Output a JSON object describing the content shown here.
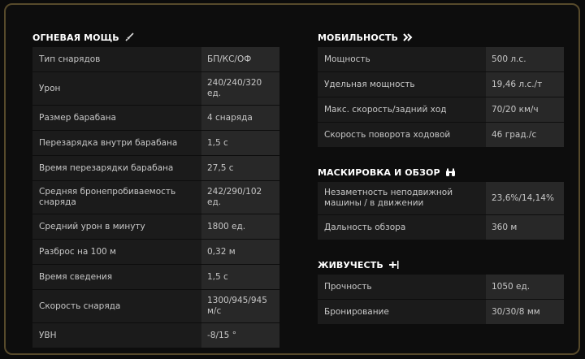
{
  "firepower": {
    "title": "ОГНЕВАЯ МОЩЬ",
    "icon": "sword-icon",
    "rows": [
      {
        "label": "Тип снарядов",
        "value": "БП/КС/ОФ"
      },
      {
        "label": "Урон",
        "value": "240/240/320 ед."
      },
      {
        "label": "Размер барабана",
        "value": "4 снаряда"
      },
      {
        "label": "Перезарядка внутри барабана",
        "value": "1,5 с"
      },
      {
        "label": "Время перезарядки барабана",
        "value": "27,5 с"
      },
      {
        "label": "Средняя бронепробиваемость снаряда",
        "value": "242/290/102 ед."
      },
      {
        "label": "Средний урон в минуту",
        "value": "1800 ед."
      },
      {
        "label": "Разброс на 100 м",
        "value": "0,32 м"
      },
      {
        "label": "Время сведения",
        "value": "1,5 с"
      },
      {
        "label": "Скорость снаряда",
        "value": "1300/945/945 м/с"
      },
      {
        "label": "УВН",
        "value": "-8/15 °"
      }
    ]
  },
  "mobility": {
    "title": "МОБИЛЬНОСТЬ",
    "icon": "double-chevron-right-icon",
    "rows": [
      {
        "label": "Мощность",
        "value": "500 л.с."
      },
      {
        "label": "Удельная мощность",
        "value": "19,46 л.с./т"
      },
      {
        "label": "Макс. скорость/задний ход",
        "value": "70/20 км/ч"
      },
      {
        "label": "Скорость поворота ходовой",
        "value": "46 град./с"
      }
    ]
  },
  "camouflage": {
    "title": "МАСКИРОВКА И ОБЗОР",
    "icon": "binoculars-icon",
    "rows": [
      {
        "label": "Незаметность неподвижной машины / в движении",
        "value": "23,6%/14,14%"
      },
      {
        "label": "Дальность обзора",
        "value": "360 м"
      }
    ]
  },
  "survivability": {
    "title": "ЖИВУЧЕСТЬ",
    "icon": "health-plus-icon",
    "rows": [
      {
        "label": "Прочность",
        "value": "1050 ед."
      },
      {
        "label": "Бронирование",
        "value": "30/30/8 мм"
      }
    ]
  },
  "colors": {
    "accent_border": "#574a2b",
    "row_bg": "#1b1b1b",
    "value_bg": "#282828",
    "text": "#c7c7c7"
  }
}
